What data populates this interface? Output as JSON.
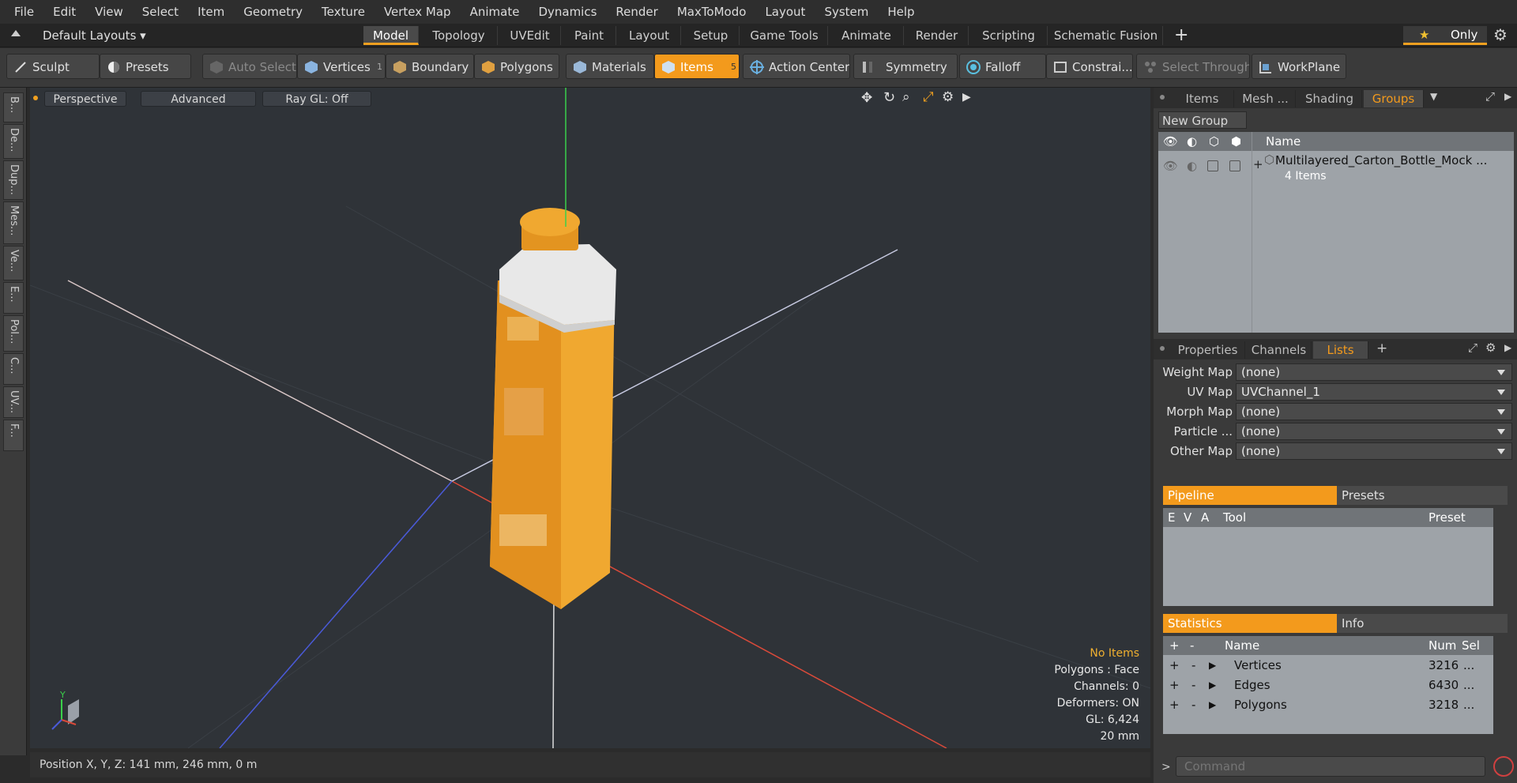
{
  "menu": [
    "File",
    "Edit",
    "View",
    "Select",
    "Item",
    "Geometry",
    "Texture",
    "Vertex Map",
    "Animate",
    "Dynamics",
    "Render",
    "MaxToModo",
    "Layout",
    "System",
    "Help"
  ],
  "layoutbar": {
    "layouts_label": "Default Layouts",
    "tabs": [
      "Model",
      "Topology",
      "UVEdit",
      "Paint",
      "Layout",
      "Setup",
      "Game Tools",
      "Animate",
      "Render",
      "Scripting",
      "Schematic Fusion"
    ],
    "active_tab": "Model",
    "add_label": "+",
    "only_label": "Only"
  },
  "toolbar": {
    "sculpt": "Sculpt",
    "presets": "Presets",
    "auto_select": "Auto Select",
    "vertices": "Vertices",
    "vertices_count": "1",
    "boundary": "Boundary",
    "polygons": "Polygons",
    "materials": "Materials",
    "items": "Items",
    "items_count": "5",
    "action_center": "Action Center",
    "symmetry": "Symmetry",
    "falloff": "Falloff",
    "constraints": "Constrai...",
    "select_through": "Select Through",
    "workplane": "WorkPlane"
  },
  "left_tabs": [
    "B...",
    "De...",
    "Dup...",
    "Mes...",
    "Ve...",
    "E...",
    "Pol...",
    "C...",
    "UV...",
    "F..."
  ],
  "viewport": {
    "view_mode": "Perspective",
    "shading": "Advanced",
    "raygl": "Ray GL: Off",
    "hud": {
      "selection": "No Items",
      "polygons": "Polygons : Face",
      "channels": "Channels: 0",
      "deformers": "Deformers: ON",
      "gl": "GL: 6,424",
      "grid": "20 mm"
    },
    "axis_y": "Y"
  },
  "status": {
    "position": "Position X, Y, Z:   141 mm, 246 mm, 0 m"
  },
  "top_panel": {
    "tabs": [
      "Items",
      "Mesh ...",
      "Shading",
      "Groups"
    ],
    "active_tab": "Groups",
    "new_group": "New Group",
    "col_name": "Name",
    "group_name": "Multilayered_Carton_Bottle_Mock ...",
    "group_count": "4 Items"
  },
  "mid_panel": {
    "tabs": [
      "Properties",
      "Channels",
      "Lists"
    ],
    "active_tab": "Lists",
    "rows": [
      {
        "label": "Weight Map",
        "value": "(none)"
      },
      {
        "label": "UV Map",
        "value": "UVChannel_1"
      },
      {
        "label": "Morph Map",
        "value": "(none)"
      },
      {
        "label": "Particle ...",
        "value": "(none)"
      },
      {
        "label": "Other Map",
        "value": "(none)"
      }
    ]
  },
  "pipeline": {
    "tabs": [
      "Pipeline",
      "Presets"
    ],
    "cols": [
      "E",
      "V",
      "A",
      "Tool",
      "Preset"
    ]
  },
  "stats": {
    "tabs": [
      "Statistics",
      "Info"
    ],
    "cols": [
      "+",
      "-",
      "Name",
      "Num",
      "Sel"
    ],
    "rows": [
      {
        "plus": "+",
        "minus": "-",
        "name": "Vertices",
        "num": "3216",
        "sel": "..."
      },
      {
        "plus": "+",
        "minus": "-",
        "name": "Edges",
        "num": "6430",
        "sel": "..."
      },
      {
        "plus": "+",
        "minus": "-",
        "name": "Polygons",
        "num": "3218",
        "sel": "..."
      }
    ]
  },
  "command": {
    "placeholder": "Command"
  },
  "colors": {
    "accent": "#f39a1c",
    "viewport_bg": "#2f3338",
    "x_axis": "#d94a3a",
    "y_axis": "#3ad04a",
    "z_axis": "#4a5ad8"
  }
}
